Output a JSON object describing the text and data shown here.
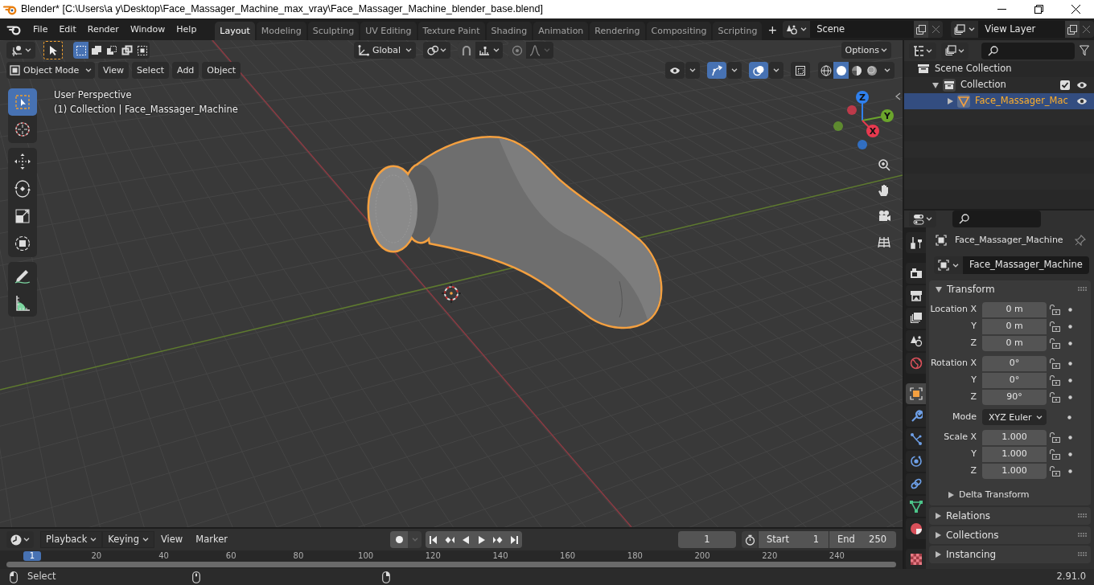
{
  "window": {
    "title": "Blender* [C:\\Users\\a y\\Desktop\\Face_Massager_Machine_max_vray\\Face_Massager_Machine_blender_base.blend]"
  },
  "menu": [
    "File",
    "Edit",
    "Render",
    "Window",
    "Help"
  ],
  "workspace_tabs": [
    {
      "label": "Layout",
      "selected": true
    },
    {
      "label": "Modeling",
      "selected": false
    },
    {
      "label": "Sculpting",
      "selected": false
    },
    {
      "label": "UV Editing",
      "selected": false
    },
    {
      "label": "Texture Paint",
      "selected": false
    },
    {
      "label": "Shading",
      "selected": false
    },
    {
      "label": "Animation",
      "selected": false
    },
    {
      "label": "Rendering",
      "selected": false
    },
    {
      "label": "Compositing",
      "selected": false
    },
    {
      "label": "Scripting",
      "selected": false
    }
  ],
  "add_tab": "+",
  "scene": {
    "value": "Scene"
  },
  "view_layer": {
    "value": "View Layer"
  },
  "tool_header": {
    "select_modes": [
      {
        "kind": "set",
        "selected": true
      },
      {
        "kind": "extend",
        "selected": false
      },
      {
        "kind": "subtract",
        "selected": false
      },
      {
        "kind": "difference",
        "selected": false
      },
      {
        "kind": "intersect",
        "selected": false
      }
    ],
    "orientation": "Global",
    "options": "Options"
  },
  "viewport_header": {
    "mode": "Object Mode",
    "menus": [
      "View",
      "Select",
      "Add",
      "Object"
    ],
    "toggles": [
      {
        "kind": "visibility",
        "on": false
      },
      {
        "kind": "gizmos",
        "on": true
      },
      {
        "kind": "overlays",
        "on": true
      },
      {
        "kind": "xray",
        "on": false
      }
    ],
    "shading": [
      {
        "kind": "wireframe",
        "selected": false
      },
      {
        "kind": "solid",
        "selected": true
      },
      {
        "kind": "material",
        "selected": false
      },
      {
        "kind": "rendered",
        "selected": false
      }
    ]
  },
  "viewport": {
    "overlay_text": [
      "User Perspective",
      "(1) Collection | Face_Massager_Machine"
    ],
    "tools": [
      {
        "kind": "select-box",
        "selected": true
      },
      {
        "kind": "cursor",
        "selected": false
      },
      {
        "kind": "move",
        "selected": false
      },
      {
        "kind": "rotate",
        "selected": false
      },
      {
        "kind": "scale",
        "selected": false
      },
      {
        "kind": "transform",
        "selected": false
      },
      {
        "kind": "annotate",
        "selected": false
      },
      {
        "kind": "measure",
        "selected": false
      }
    ],
    "gizmo_axes": [
      {
        "label": "Z",
        "color": "#2f80ed"
      },
      {
        "label": "Y",
        "color": "#6ba52c"
      },
      {
        "label": "X",
        "color": "#e8394f"
      }
    ]
  },
  "outliner": {
    "items": [
      {
        "label": "Scene Collection",
        "kind": "scene_collection",
        "selected": false,
        "children": [
          {
            "label": "Collection",
            "kind": "collection",
            "selected": false,
            "expanded": true,
            "checked": true,
            "visible": true,
            "children": [
              {
                "label": "Face_Massager_Mac",
                "kind": "mesh_object",
                "selected": true,
                "expanded": false,
                "visible": true
              }
            ]
          }
        ]
      }
    ]
  },
  "properties": {
    "tabs": [
      {
        "kind": "tool",
        "selected": false
      },
      {
        "kind": "render",
        "selected": false
      },
      {
        "kind": "output",
        "selected": false
      },
      {
        "kind": "view_layer",
        "selected": false
      },
      {
        "kind": "scene",
        "selected": false
      },
      {
        "kind": "world",
        "selected": false
      },
      {
        "kind": "object",
        "selected": true
      },
      {
        "kind": "modifiers",
        "selected": false
      },
      {
        "kind": "particles",
        "selected": false
      },
      {
        "kind": "physics",
        "selected": false
      },
      {
        "kind": "constraints",
        "selected": false
      },
      {
        "kind": "data",
        "selected": false
      },
      {
        "kind": "material",
        "selected": false
      },
      {
        "kind": "texture",
        "selected": false
      }
    ],
    "object_name": "Face_Massager_Machine",
    "data_name": "Face_Massager_Machine",
    "transform": {
      "title": "Transform",
      "expanded": true,
      "groups": [
        [
          {
            "kind": "number",
            "label": "Location X",
            "value": "0 m"
          },
          {
            "kind": "number",
            "label": "Y",
            "value": "0 m"
          },
          {
            "kind": "number",
            "label": "Z",
            "value": "0 m"
          }
        ],
        [
          {
            "kind": "number",
            "label": "Rotation X",
            "value": "0°"
          },
          {
            "kind": "number",
            "label": "Y",
            "value": "0°"
          },
          {
            "kind": "number",
            "label": "Z",
            "value": "90°"
          }
        ],
        [
          {
            "kind": "dropdown",
            "label": "Mode",
            "value": "XYZ Euler"
          }
        ],
        [
          {
            "kind": "number",
            "label": "Scale X",
            "value": "1.000"
          },
          {
            "kind": "number",
            "label": "Y",
            "value": "1.000"
          },
          {
            "kind": "number",
            "label": "Z",
            "value": "1.000"
          }
        ]
      ],
      "subpanels": [
        {
          "title": "Delta Transform",
          "expanded": false
        }
      ]
    },
    "panels": [
      {
        "title": "Relations",
        "expanded": false
      },
      {
        "title": "Collections",
        "expanded": false
      },
      {
        "title": "Instancing",
        "expanded": false
      }
    ]
  },
  "timeline": {
    "menus": [
      {
        "label": "Playback",
        "kind": "dropdown"
      },
      {
        "label": "Keying",
        "kind": "dropdown"
      },
      {
        "label": "View",
        "kind": "menu"
      },
      {
        "label": "Marker",
        "kind": "menu"
      }
    ],
    "current_frame": "1",
    "start": {
      "label": "Start",
      "value": "1"
    },
    "end": {
      "label": "End",
      "value": "250"
    },
    "ruler": {
      "current": "1",
      "ticks": [
        "20",
        "40",
        "60",
        "80",
        "100",
        "120",
        "140",
        "160",
        "180",
        "200",
        "220",
        "240"
      ]
    }
  },
  "status_bar": {
    "action": "Select",
    "version": "2.91.0"
  }
}
